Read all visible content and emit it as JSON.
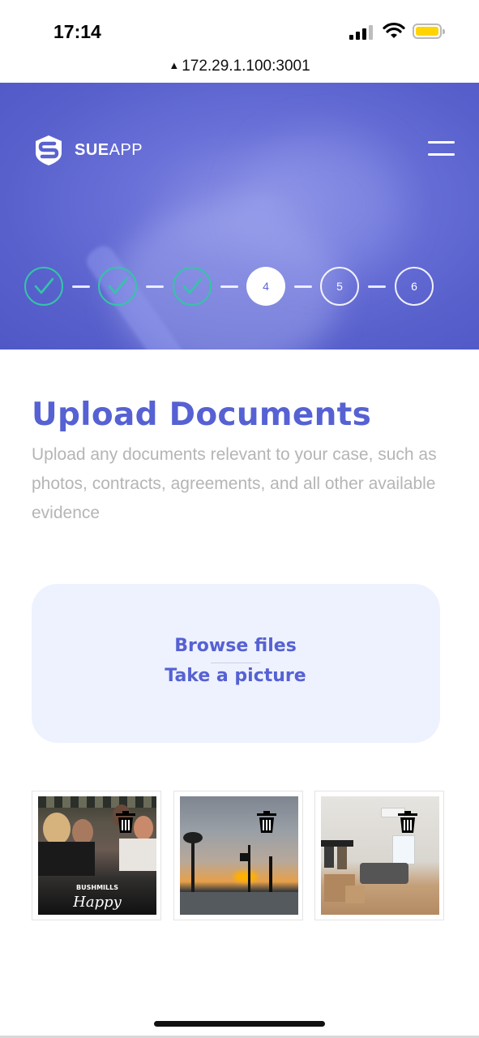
{
  "status_bar": {
    "time": "17:14"
  },
  "browser": {
    "url": "172.29.1.100:3001",
    "warning_icon": "warning-triangle-icon"
  },
  "header": {
    "logo_bold": "SUE",
    "logo_light": "APP",
    "menu_icon": "hamburger-menu-icon"
  },
  "stepper": {
    "steps": [
      {
        "label": "",
        "state": "completed"
      },
      {
        "label": "",
        "state": "completed"
      },
      {
        "label": "",
        "state": "completed"
      },
      {
        "label": "4",
        "state": "current"
      },
      {
        "label": "5",
        "state": "upcoming"
      },
      {
        "label": "6",
        "state": "upcoming"
      }
    ]
  },
  "page": {
    "title": "Upload Documents",
    "description": "Upload any documents relevant to your case, such as photos, contracts, agreements, and all other available evidence"
  },
  "upload": {
    "browse_label": "Browse files",
    "camera_label": "Take a picture"
  },
  "thumbnails": [
    {
      "photo_text": [
        "BUSHMILLS",
        "Happy"
      ],
      "delete_icon": "trash-icon"
    },
    {
      "photo_text": [],
      "delete_icon": "trash-icon"
    },
    {
      "photo_text": [],
      "delete_icon": "trash-icon"
    }
  ],
  "colors": {
    "accent": "#5661d3",
    "step_done": "#35c4a8",
    "upload_bg": "#eef2fe",
    "battery": "#ffd400"
  }
}
